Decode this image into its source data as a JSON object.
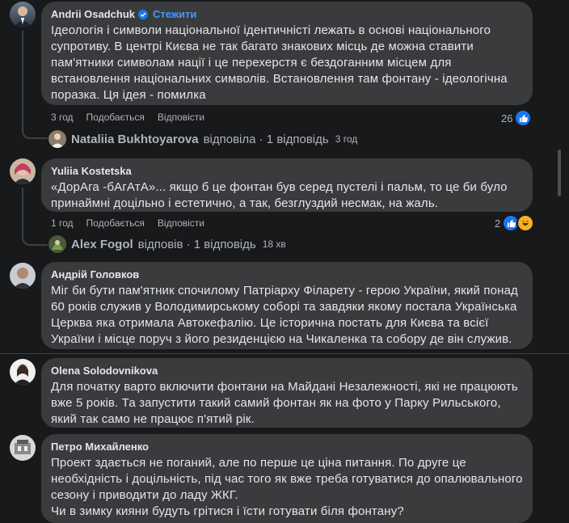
{
  "comments": [
    {
      "author": "Andrii Osadchuk",
      "follow_label": "Стежити",
      "text": "Ідеологія і символи національної ідентичністі лежать в основі національного супротиву. В центрі Києва не так багато знакових місць де можна ставити пам'ятники символам нації і це перехерстя є бездоганним місцем для встановлення національних символів. Встановлення там фонтану - ідеологічна поразка. Ця ідея - помилка",
      "time": "3 год",
      "like": "Подобається",
      "reply": "Відповісти",
      "reaction_count": "26",
      "reply_summary": {
        "who": "Nataliia Bukhtoyarova",
        "verb": "відповіла · 1 відповідь",
        "time": "3 год"
      }
    },
    {
      "author": "Yuliia Kostetska",
      "text": "«ДорАга -бАгАтА»... якщо б це фонтан був серед пустелі і пальм, то це би було принаймні доцільно і естетично, а так, безглуздий несмак, на жаль.",
      "time": "1 год",
      "like": "Подобається",
      "reply": "Відповісти",
      "reaction_count": "2",
      "reply_summary": {
        "who": "Alex Fogol",
        "verb": "відповів · 1 відповідь",
        "time": "18 хв"
      }
    },
    {
      "author": "Андрій Головков",
      "text": "Міг би бути пам'ятник спочилому Патріарху Філарету - герою України, який понад 60 років служив у Володимирському соборі та завдяки якому постала Українська Церква яка отримала Автокефалію. Це історична постать для Києва та всієї України і місце поруч з його резиденцією на Чикаленка та собору де він служив."
    },
    {
      "author": "Olena Solodovnikova",
      "text": "Для початку варто включити фонтани на Майдані Незалежності, які не працюють вже 5 років. Та запустити такий самий фонтан як на фото у Парку Рильського, який так само не працює п'ятий рік."
    },
    {
      "author": "Петро Михайленко",
      "text": "Проект здається не поганий, але по перше це ціна питання. По друге це необхідність і доцільність, під час того як вже треба готуватися до опалювального сезону і приводити до ладу ЖКГ.\nЧи в зимку кияни будуть грітися і їсти готувати біля фонтану?"
    }
  ],
  "colors": {
    "background": "#18191a",
    "bubble": "#3a3b3c",
    "text": "#e4e6eb",
    "muted": "#b0b3b8",
    "link": "#4599ff",
    "like": "#1877f2",
    "haha": "#f7b125"
  },
  "icons": [
    "verified-badge-icon",
    "like-reaction-icon",
    "haha-reaction-icon"
  ]
}
